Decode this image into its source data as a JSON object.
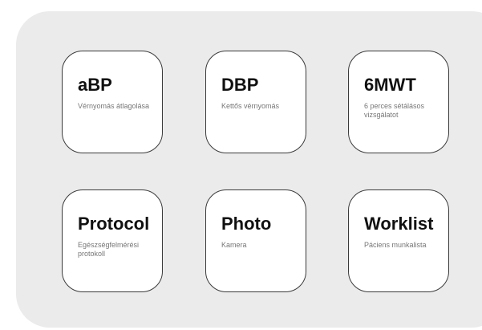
{
  "tiles": [
    {
      "title": "aBP",
      "subtitle": "Vérnyomás átlagolása"
    },
    {
      "title": "DBP",
      "subtitle": "Kettős vérnyomás"
    },
    {
      "title": "6MWT",
      "subtitle": "6 perces sétálásos vizsgálatot"
    },
    {
      "title": "Protocol",
      "subtitle": "Egészségfelmérési protokoll"
    },
    {
      "title": "Photo",
      "subtitle": "Kamera"
    },
    {
      "title": "Worklist",
      "subtitle": "Páciens munkalista"
    }
  ]
}
